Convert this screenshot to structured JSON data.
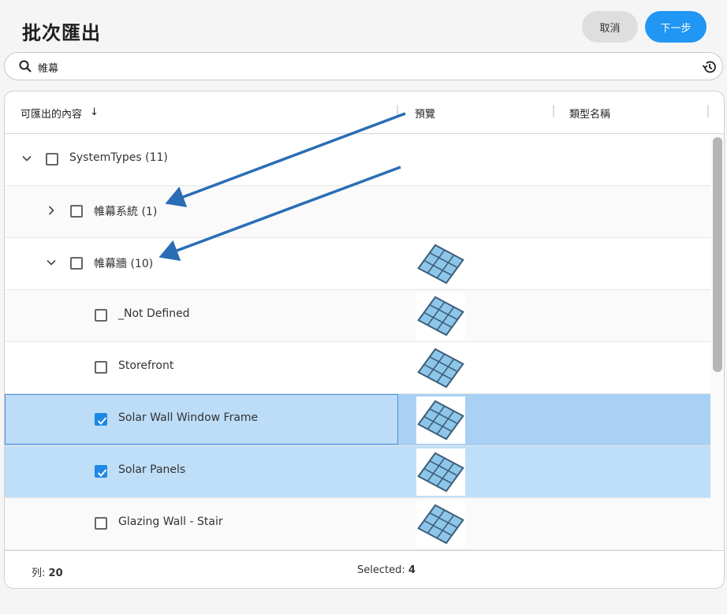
{
  "dialog": {
    "title": "批次匯出",
    "cancel_label": "取消",
    "next_label": "下一步"
  },
  "search": {
    "value": "帷幕",
    "placeholder": ""
  },
  "table": {
    "columns": {
      "content": "可匯出的內容",
      "preview": "預覽",
      "type_name": "類型名稱"
    },
    "sort_indicator": "↓",
    "rows": [
      {
        "label": "SystemTypes (11)",
        "level": 0,
        "expander": "expanded",
        "checked": false,
        "preview": false
      },
      {
        "label": "帷幕系統 (1)",
        "level": 1,
        "expander": "collapsed",
        "checked": false,
        "preview": false
      },
      {
        "label": "帷幕牆 (10)",
        "level": 1,
        "expander": "expanded",
        "checked": false,
        "preview": true
      },
      {
        "label": "_Not Defined",
        "level": 2,
        "checked": false,
        "preview": true
      },
      {
        "label": "Storefront",
        "level": 2,
        "checked": false,
        "preview": true
      },
      {
        "label": "Solar Wall Window Frame",
        "level": 2,
        "checked": true,
        "preview": true,
        "selected": true
      },
      {
        "label": "Solar Panels",
        "level": 2,
        "checked": true,
        "preview": true,
        "selected": true
      },
      {
        "label": "Glazing Wall - Stair",
        "level": 2,
        "checked": false,
        "preview": true
      }
    ]
  },
  "footer": {
    "rows_label": "列:",
    "rows_count": "20",
    "selected_label": "Selected:",
    "selected_count": "4"
  },
  "colors": {
    "accent": "#2196f3",
    "selected_row": "#a9d0f5",
    "selected_row_alt": "#bfdff8",
    "annotation_arrow": "#2a6db5"
  }
}
